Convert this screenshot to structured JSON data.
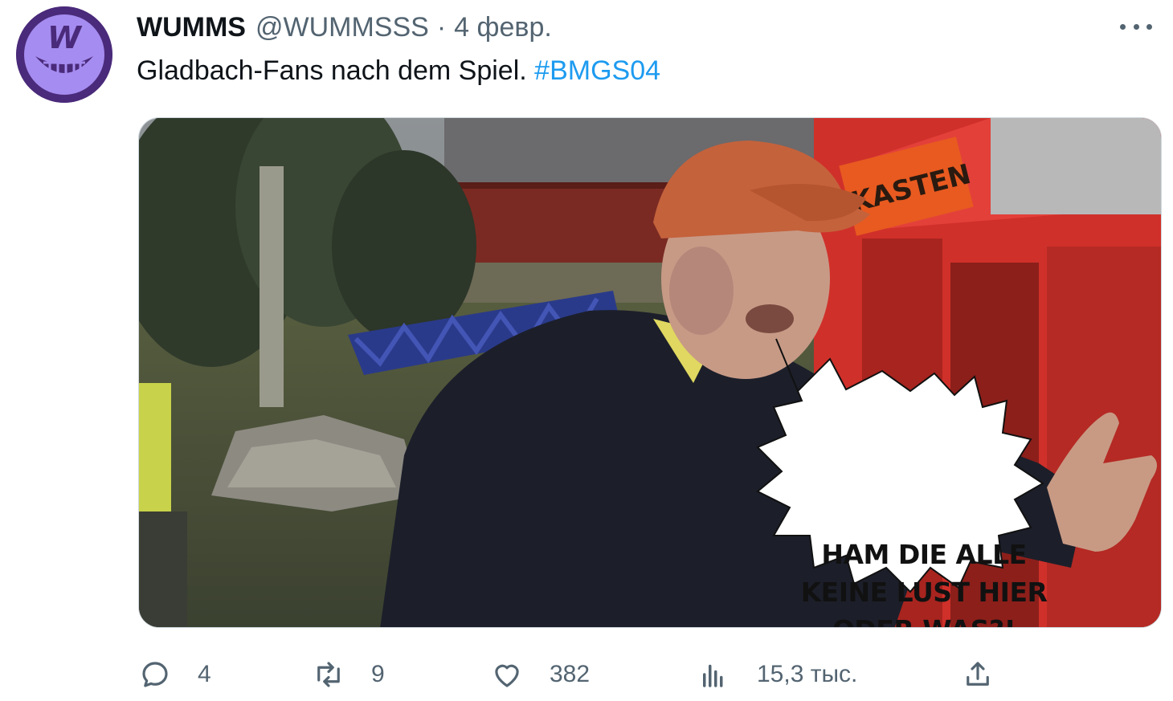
{
  "tweet": {
    "display_name": "WUMMS",
    "handle": "@WUMMSSS",
    "separator": "·",
    "date": "4 февр.",
    "text": "Gladbach-Fans nach dem Spiel.",
    "hashtag": "#BMGS04",
    "avatar_letter": "W",
    "more_icon": "more-dots-icon"
  },
  "media": {
    "caption": "HAM DIE ALLE\nKEINE LUST HIER\nODER WAS?!",
    "sign_text": "KASTEN"
  },
  "actions": {
    "reply": {
      "icon": "reply-icon",
      "count": "4"
    },
    "retweet": {
      "icon": "retweet-icon",
      "count": "9"
    },
    "like": {
      "icon": "heart-icon",
      "count": "382"
    },
    "views": {
      "icon": "views-chart-icon",
      "count": "15,3 тыс."
    },
    "share": {
      "icon": "share-icon"
    }
  },
  "colors": {
    "text_primary": "#0f1419",
    "text_secondary": "#536471",
    "link": "#1d9bf0",
    "avatar_bg": "#4a2a7a",
    "avatar_accent": "#a58cf0"
  }
}
